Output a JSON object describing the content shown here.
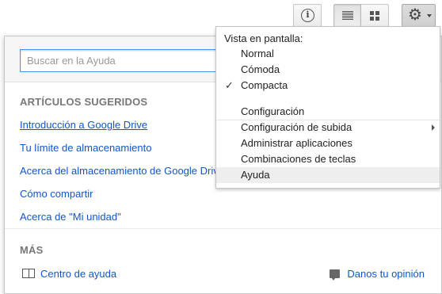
{
  "toolbar": {
    "info_glyph": "i",
    "gear_glyph": "⚙"
  },
  "help_panel": {
    "search_placeholder": "Buscar en la Ayuda",
    "suggested_title": "ARTÍCULOS SUGERIDOS",
    "articles": [
      "Introducción a Google Drive",
      "Tu límite de almacenamiento",
      "Acerca del almacenamiento de Google Drive",
      "Cómo compartir",
      "Acerca de \"Mi unidad\""
    ],
    "more_title": "MÁS",
    "help_center_label": "Centro de ayuda",
    "feedback_label": "Danos tu opinión"
  },
  "settings_menu": {
    "display_header": "Vista en pantalla:",
    "display_options": [
      "Normal",
      "Cómoda",
      "Compacta"
    ],
    "selected_display": "Compacta",
    "check_glyph": "✓",
    "items": [
      "Configuración",
      "Configuración de subida",
      "Administrar aplicaciones",
      "Combinaciones de teclas",
      "Ayuda"
    ],
    "highlighted_item": "Ayuda"
  },
  "colors": {
    "link": "#1155cc",
    "focus_border": "#4d90fe",
    "section_title": "#777777"
  }
}
